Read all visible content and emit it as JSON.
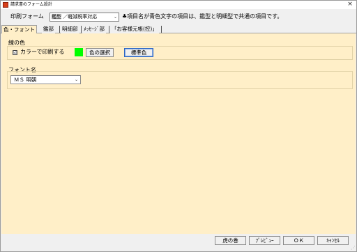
{
  "window": {
    "title": "請求書のフォーム設計",
    "close_glyph": "×"
  },
  "toolbar": {
    "form_label": "印刷フォーム",
    "form_select": {
      "value_main": "鑑型",
      "value_rest": " ／軽減税率対応",
      "chevron": "⌄"
    },
    "note": "♣項目名が青色文字の項目は、鑑型と明細型で共通の項目です。"
  },
  "tabs": [
    {
      "label": "色・フォント",
      "active": true
    },
    {
      "label": "鑑部",
      "active": false
    },
    {
      "label": "明細部",
      "active": false
    },
    {
      "label": "ﾒｯｾｰｼﾞ部",
      "active": false
    },
    {
      "label": "「お客様元帳(控)」",
      "active": false
    }
  ],
  "line_color": {
    "group_label": "線の色",
    "checkbox_label": "カラーで印刷する",
    "checkbox_mark": "☑",
    "checked": true,
    "swatch_color": "#00ff00",
    "choose_button": "色の選択",
    "standard_button": "標準色"
  },
  "font": {
    "group_label": "フォント名",
    "value": "ＭＳ 明朝",
    "chevron": "⌄"
  },
  "footer": {
    "buttons": [
      "虎の巻",
      "ﾌﾟﾚﾋﾞｭｰ",
      "ＯＫ",
      "ｷｬﾝｾﾙ"
    ],
    "grip": "⋰"
  },
  "colors": {
    "panel_bg": "#ffefc8",
    "chrome_bg": "#f0f0f0",
    "default_button_border": "#2c66c4"
  }
}
